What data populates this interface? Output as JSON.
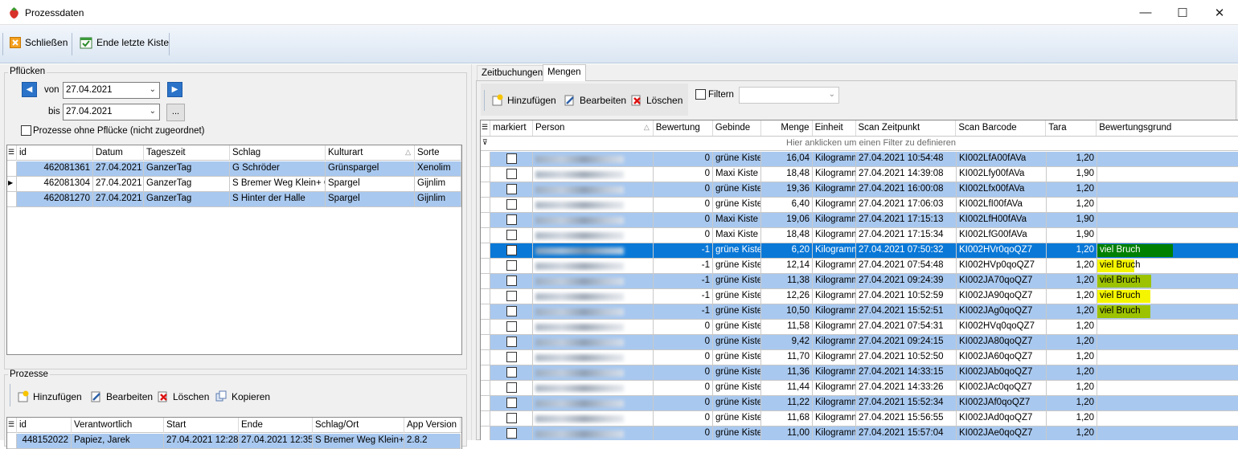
{
  "window": {
    "title": "Prozessdaten",
    "minimize": "—",
    "maximize": "☐",
    "close": "✕"
  },
  "toolbar": {
    "close_label": "Schließen",
    "end_label": "Ende letzte Kiste"
  },
  "pfluecken": {
    "group_label": "Pflücken",
    "von_label": "von",
    "von_value": "27.04.2021",
    "bis_label": "bis",
    "bis_value": "27.04.2021",
    "ellipsis": "...",
    "checkbox_label": "Prozesse ohne Pflücke (nicht zugeordnet)",
    "columns": [
      "id",
      "Datum",
      "Tageszeit",
      "Schlag",
      "Kulturart",
      "Sorte"
    ],
    "rows": [
      [
        "462081361",
        "27.04.2021",
        "GanzerTag",
        "G Schröder",
        "Grünspargel",
        "Xenolim"
      ],
      [
        "462081304",
        "27.04.2021",
        "GanzerTag",
        "S Bremer Weg Klein+ Gr",
        "Spargel",
        "Gijnlim"
      ],
      [
        "462081270",
        "27.04.2021",
        "GanzerTag",
        "S Hinter der Halle",
        "Spargel",
        "Gijnlim"
      ]
    ]
  },
  "prozesse": {
    "group_label": "Prozesse",
    "add": "Hinzufügen",
    "edit": "Bearbeiten",
    "delete": "Löschen",
    "copy": "Kopieren",
    "columns": [
      "id",
      "Verantwortlich",
      "Start",
      "Ende",
      "Schlag/Ort",
      "App Version"
    ],
    "rows": [
      [
        "448152022",
        "Papiez, Jarek",
        "27.04.2021 12:28",
        "27.04.2021 12:35",
        "S Bremer Weg Klein+ G",
        "2.8.2"
      ]
    ]
  },
  "tabs": {
    "zeitbuchungen": "Zeitbuchungen",
    "mengen": "Mengen"
  },
  "mengen": {
    "add": "Hinzufügen",
    "edit": "Bearbeiten",
    "delete": "Löschen",
    "filter_label": "Filtern",
    "columns": [
      "markiert",
      "Person",
      "Bewertung",
      "Gebinde",
      "Menge",
      "Einheit",
      "Scan Zeitpunkt",
      "Scan Barcode",
      "Tara",
      "Bewertungsgrund"
    ],
    "filter_hint": "Hier anklicken um einen Filter zu definieren",
    "rows": [
      [
        "0",
        "grüne Kiste",
        "16,04",
        "Kilogramm",
        "27.04.2021 10:54:48",
        "KI002LfA00fAVa",
        "1,20",
        ""
      ],
      [
        "0",
        "Maxi Kiste",
        "18,48",
        "Kilogramm",
        "27.04.2021 14:39:08",
        "KI002Lfy00fAVa",
        "1,90",
        ""
      ],
      [
        "0",
        "grüne Kiste",
        "19,36",
        "Kilogramm",
        "27.04.2021 16:00:08",
        "KI002Lfx00fAVa",
        "1,20",
        ""
      ],
      [
        "0",
        "grüne Kiste",
        "6,40",
        "Kilogramm",
        "27.04.2021 17:06:03",
        "KI002LfI00fAVa",
        "1,20",
        ""
      ],
      [
        "0",
        "Maxi Kiste",
        "19,06",
        "Kilogramm",
        "27.04.2021 17:15:13",
        "KI002LfH00fAVa",
        "1,90",
        ""
      ],
      [
        "0",
        "Maxi Kiste",
        "18,48",
        "Kilogramm",
        "27.04.2021 17:15:34",
        "KI002LfG00fAVa",
        "1,90",
        ""
      ],
      [
        "-1",
        "grüne Kiste",
        "6,20",
        "Kilogramm",
        "27.04.2021 07:50:32",
        "KI002HVr0qoQZ7",
        "1,20",
        "viel Bruch"
      ],
      [
        "-1",
        "grüne Kiste",
        "12,14",
        "Kilogramm",
        "27.04.2021 07:54:48",
        "KI002HVp0qoQZ7",
        "1,20",
        "viel Bruch"
      ],
      [
        "-1",
        "grüne Kiste",
        "11,38",
        "Kilogramm",
        "27.04.2021 09:24:39",
        "KI002JA70qoQZ7",
        "1,20",
        "viel Bruch"
      ],
      [
        "-1",
        "grüne Kiste",
        "12,26",
        "Kilogramm",
        "27.04.2021 10:52:59",
        "KI002JA90qoQZ7",
        "1,20",
        "viel Bruch"
      ],
      [
        "-1",
        "grüne Kiste",
        "10,50",
        "Kilogramm",
        "27.04.2021 15:52:51",
        "KI002JAg0qoQZ7",
        "1,20",
        "viel Bruch"
      ],
      [
        "0",
        "grüne Kiste",
        "11,58",
        "Kilogramm",
        "27.04.2021 07:54:31",
        "KI002HVq0qoQZ7",
        "1,20",
        ""
      ],
      [
        "0",
        "grüne Kiste",
        "9,42",
        "Kilogramm",
        "27.04.2021 09:24:15",
        "KI002JA80qoQZ7",
        "1,20",
        ""
      ],
      [
        "0",
        "grüne Kiste",
        "11,70",
        "Kilogramm",
        "27.04.2021 10:52:50",
        "KI002JA60qoQZ7",
        "1,20",
        ""
      ],
      [
        "0",
        "grüne Kiste",
        "11,36",
        "Kilogramm",
        "27.04.2021 14:33:15",
        "KI002JAb0qoQZ7",
        "1,20",
        ""
      ],
      [
        "0",
        "grüne Kiste",
        "11,44",
        "Kilogramm",
        "27.04.2021 14:33:26",
        "KI002JAc0qoQZ7",
        "1,20",
        ""
      ],
      [
        "0",
        "grüne Kiste",
        "11,22",
        "Kilogramm",
        "27.04.2021 15:52:34",
        "KI002JAf0qoQZ7",
        "1,20",
        ""
      ],
      [
        "0",
        "grüne Kiste",
        "11,68",
        "Kilogramm",
        "27.04.2021 15:56:55",
        "KI002JAd0qoQZ7",
        "1,20",
        ""
      ],
      [
        "0",
        "grüne Kiste",
        "11,00",
        "Kilogramm",
        "27.04.2021 15:57:04",
        "KI002JAe0qoQZ7",
        "1,20",
        ""
      ]
    ]
  },
  "colors": {
    "row_blue": "#a8c8ef",
    "selection": "#0a78d7",
    "highlight_yellow": "#f5f500",
    "highlight_green": "#9cc200",
    "highlight_dark_green": "#008000"
  }
}
